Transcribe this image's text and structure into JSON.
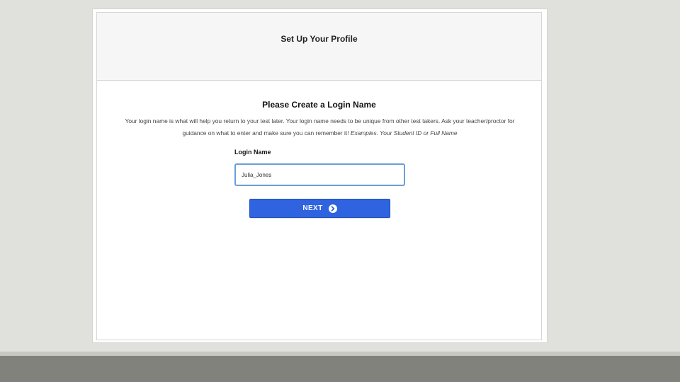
{
  "header": {
    "title": "Set Up Your Profile"
  },
  "main": {
    "heading": "Please Create a Login Name",
    "description_text": "Your login name is what will help you return to your test later. Your login name needs to be unique from other test takers. Ask your teacher/proctor for guidance on what to enter and make sure you can remember it! ",
    "description_examples": "Examples. Your Student ID or Full Name",
    "login_field": {
      "label": "Login Name",
      "value": "Julia_Jones"
    },
    "next_button": {
      "label": "NEXT",
      "icon": "arrow-right-circle-icon"
    }
  },
  "colors": {
    "button_blue": "#2f63e0",
    "input_focus_border": "#6a9edb",
    "background": "#e0e0dc",
    "bottom_band": "#82827c"
  }
}
